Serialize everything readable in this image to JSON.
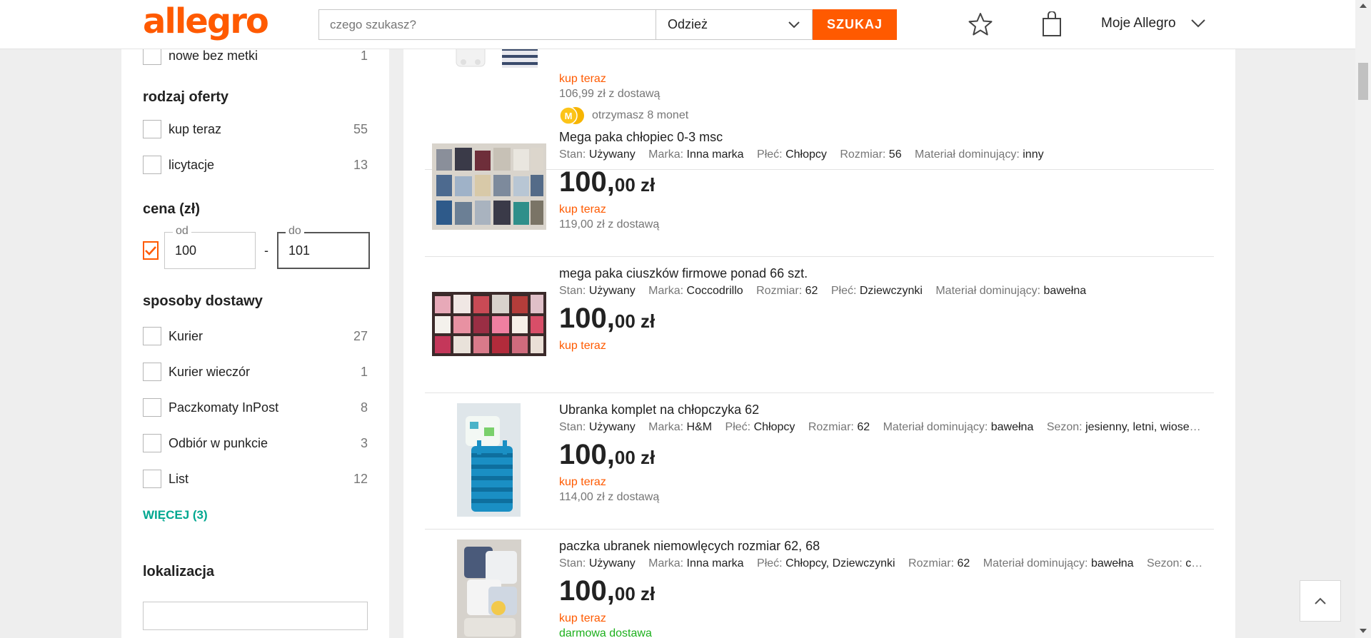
{
  "header": {
    "logo": "allegro",
    "search_placeholder": "czego szukasz?",
    "category": "Odzież",
    "search_button": "SZUKAJ",
    "account": "Moje Allegro"
  },
  "sidebar": {
    "condition_item": {
      "label": "nowe bez metki",
      "count": "1"
    },
    "offer_type": {
      "title": "rodzaj oferty",
      "items": [
        {
          "label": "kup teraz",
          "count": "55"
        },
        {
          "label": "licytacje",
          "count": "13"
        }
      ]
    },
    "price": {
      "title": "cena (zł)",
      "from_label": "od",
      "from_value": "100",
      "to_label": "do",
      "to_value": "101",
      "separator": "-"
    },
    "delivery": {
      "title": "sposoby dostawy",
      "items": [
        {
          "label": "Kurier",
          "count": "27"
        },
        {
          "label": "Kurier wieczór",
          "count": "1"
        },
        {
          "label": "Paczkomaty InPost",
          "count": "8"
        },
        {
          "label": "Odbiór w punkcie",
          "count": "3"
        },
        {
          "label": "List",
          "count": "12"
        }
      ],
      "more": "WIĘCEJ (3)"
    },
    "location": {
      "title": "lokalizacja"
    }
  },
  "listings": [
    {
      "buy_label": "kup teraz",
      "delivery": "106,99 zł z dostawą",
      "coins": "otrzymasz 8 monet"
    },
    {
      "title": "Mega paka chłopiec 0-3 msc",
      "params": [
        {
          "k": "Stan:",
          "v": "Używany"
        },
        {
          "k": "Marka:",
          "v": "Inna marka"
        },
        {
          "k": "Płeć:",
          "v": "Chłopcy"
        },
        {
          "k": "Rozmiar:",
          "v": "56"
        },
        {
          "k": "Materiał dominujący:",
          "v": "inny"
        }
      ],
      "price_main": "100,",
      "price_rest": "00 zł",
      "buy_label": "kup teraz",
      "delivery": "119,00 zł z dostawą"
    },
    {
      "title": "mega paka ciuszków firmowe ponad 66 szt.",
      "params": [
        {
          "k": "Stan:",
          "v": "Używany"
        },
        {
          "k": "Marka:",
          "v": "Coccodrillo"
        },
        {
          "k": "Rozmiar:",
          "v": "62"
        },
        {
          "k": "Płeć:",
          "v": "Dziewczynki"
        },
        {
          "k": "Materiał dominujący:",
          "v": "bawełna"
        }
      ],
      "price_main": "100,",
      "price_rest": "00 zł",
      "buy_label": "kup teraz"
    },
    {
      "title": "Ubranka komplet na chłopczyka 62",
      "params": [
        {
          "k": "Stan:",
          "v": "Używany"
        },
        {
          "k": "Marka:",
          "v": "H&M"
        },
        {
          "k": "Płeć:",
          "v": "Chłopcy"
        },
        {
          "k": "Rozmiar:",
          "v": "62"
        },
        {
          "k": "Materiał dominujący:",
          "v": "bawełna"
        },
        {
          "k": "Sezon:",
          "v": "jesienny, letni, wiosenny"
        }
      ],
      "price_main": "100,",
      "price_rest": "00 zł",
      "buy_label": "kup teraz",
      "delivery": "114,00 zł z dostawą"
    },
    {
      "title": "paczka ubranek niemowlęcych rozmiar 62, 68",
      "params": [
        {
          "k": "Stan:",
          "v": "Używany"
        },
        {
          "k": "Marka:",
          "v": "Inna marka"
        },
        {
          "k": "Płeć:",
          "v": "Chłopcy, Dziewczynki"
        },
        {
          "k": "Rozmiar:",
          "v": "62"
        },
        {
          "k": "Materiał dominujący:",
          "v": "bawełna"
        },
        {
          "k": "Sezon:",
          "v": "całoroczny"
        }
      ],
      "price_main": "100,",
      "price_rest": "00 zł",
      "buy_label": "kup teraz",
      "free_delivery": "darmowa dostawa"
    }
  ],
  "colors": {
    "accent": "#ff5a00",
    "link": "#00a790",
    "free": "#1db01d"
  }
}
